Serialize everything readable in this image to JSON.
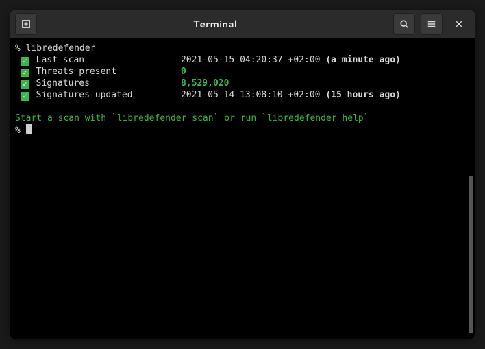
{
  "window": {
    "title": "Terminal"
  },
  "term": {
    "prompt": "%",
    "command": "libredefender",
    "rows": [
      {
        "label": "Last scan",
        "value": "2021-05-15 04:20:37 +02:00",
        "relative": "(a minute ago)",
        "value_green": false
      },
      {
        "label": "Threats present",
        "value": "0",
        "relative": "",
        "value_green": true
      },
      {
        "label": "Signatures",
        "value": "8,529,020",
        "relative": "",
        "value_green": true
      },
      {
        "label": "Signatures updated",
        "value": "2021-05-14 13:08:10 +02:00",
        "relative": "(15 hours ago)",
        "value_green": false
      }
    ],
    "hint": "Start a scan with `libredefender scan` or run `libredefender help`"
  }
}
